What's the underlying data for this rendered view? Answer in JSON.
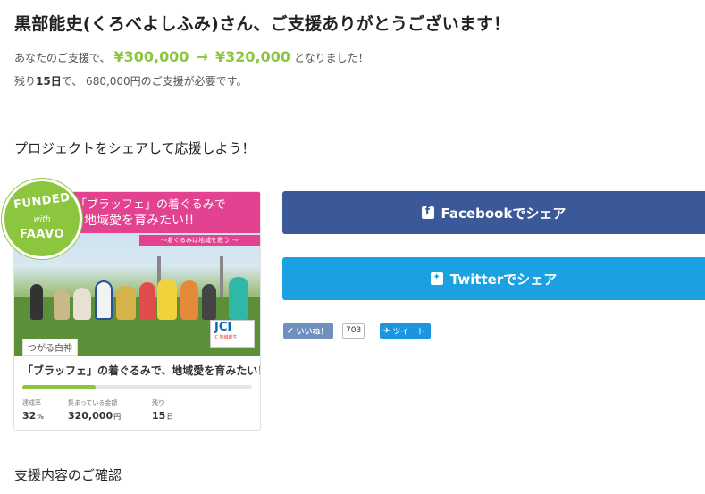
{
  "header": {
    "thanks_title": "黒部能史(くろべよしふみ)さん、ご支援ありがとうございます！",
    "amount_prefix": "あなたのご支援で、",
    "amount_before": "¥300,000",
    "amount_arrow": "→",
    "amount_after": "¥320,000",
    "amount_suffix": "となりました！",
    "remain_prefix": "残り",
    "remain_days": "15日",
    "remain_suffix": "で、 680,000円のご支援が必要です。"
  },
  "share": {
    "heading": "プロジェクトをシェアして応援しよう！",
    "facebook_label": "Facebookでシェア",
    "twitter_label": "Twitterでシェア",
    "like_label": "いいね！",
    "like_count": "703",
    "tweet_label": "ツイート",
    "icons": {
      "facebook": "facebook-icon",
      "twitter": "twitter-icon",
      "like": "thumbs-up-icon",
      "tweet": "bird-icon"
    }
  },
  "project_card": {
    "badge": {
      "line1": "FUNDED",
      "line2": "with",
      "line3": "FAAVO"
    },
    "banner_line1": "「ブラッフェ」の着ぐるみで",
    "banner_line2": "地域愛を育みたい!!",
    "banner_sub": "〜着ぐるみは地域を救う!〜",
    "logo_text": "JCI",
    "logo_sub": "JC 地域創生",
    "region_tag": "つがる白神",
    "title": "「ブラッフェ」の着ぐるみで、地域愛を育みたい！",
    "progress": 32,
    "stats": {
      "rate_label": "達成率",
      "rate_value": "32",
      "rate_unit": "%",
      "amount_label": "集まっている金額",
      "amount_value": "320,000",
      "amount_unit": "円",
      "days_label": "残り",
      "days_value": "15",
      "days_unit": "日"
    }
  },
  "confirm": {
    "heading": "支援内容のご確認"
  },
  "colors": {
    "accent_green": "#8cc63f",
    "facebook_blue": "#3b5998",
    "twitter_blue": "#1ba1e2",
    "banner_pink": "#e2428f"
  }
}
